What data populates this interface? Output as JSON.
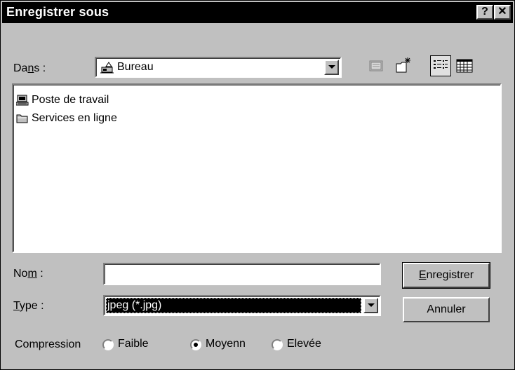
{
  "window": {
    "title": "Enregistrer sous",
    "help_label": "?",
    "close_label": "✕"
  },
  "location": {
    "label_pre": "Da",
    "label_u": "n",
    "label_post": "s :",
    "value": "Bureau"
  },
  "files": [
    {
      "name": "Poste de travail",
      "icon": "computer-icon"
    },
    {
      "name": "Services en ligne",
      "icon": "folder-icon"
    }
  ],
  "filename": {
    "label_pre": "No",
    "label_u": "m",
    "label_post": " :",
    "value": ""
  },
  "filetype": {
    "label_u": "T",
    "label_post": "ype :",
    "value": "jpeg (*.jpg)"
  },
  "buttons": {
    "save_u": "E",
    "save_post": "nregistrer",
    "cancel": "Annuler"
  },
  "compression": {
    "label": "Compression",
    "options": [
      {
        "label": "Faible",
        "selected": false
      },
      {
        "label": "Moyenn",
        "selected": true
      },
      {
        "label": "Elevée",
        "selected": false
      }
    ]
  }
}
